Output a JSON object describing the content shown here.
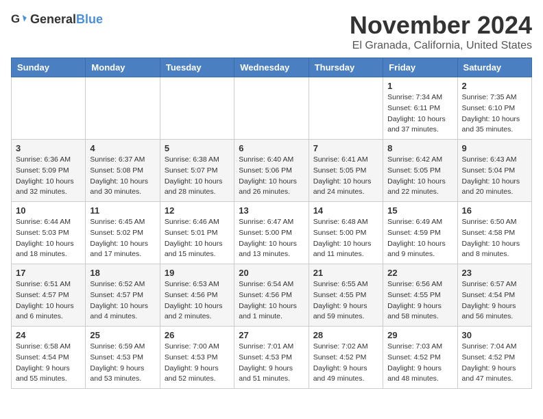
{
  "logo": {
    "general": "General",
    "blue": "Blue"
  },
  "header": {
    "month": "November 2024",
    "location": "El Granada, California, United States"
  },
  "days_of_week": [
    "Sunday",
    "Monday",
    "Tuesday",
    "Wednesday",
    "Thursday",
    "Friday",
    "Saturday"
  ],
  "weeks": [
    [
      {
        "day": "",
        "info": ""
      },
      {
        "day": "",
        "info": ""
      },
      {
        "day": "",
        "info": ""
      },
      {
        "day": "",
        "info": ""
      },
      {
        "day": "",
        "info": ""
      },
      {
        "day": "1",
        "info": "Sunrise: 7:34 AM\nSunset: 6:11 PM\nDaylight: 10 hours and 37 minutes."
      },
      {
        "day": "2",
        "info": "Sunrise: 7:35 AM\nSunset: 6:10 PM\nDaylight: 10 hours and 35 minutes."
      }
    ],
    [
      {
        "day": "3",
        "info": "Sunrise: 6:36 AM\nSunset: 5:09 PM\nDaylight: 10 hours and 32 minutes."
      },
      {
        "day": "4",
        "info": "Sunrise: 6:37 AM\nSunset: 5:08 PM\nDaylight: 10 hours and 30 minutes."
      },
      {
        "day": "5",
        "info": "Sunrise: 6:38 AM\nSunset: 5:07 PM\nDaylight: 10 hours and 28 minutes."
      },
      {
        "day": "6",
        "info": "Sunrise: 6:40 AM\nSunset: 5:06 PM\nDaylight: 10 hours and 26 minutes."
      },
      {
        "day": "7",
        "info": "Sunrise: 6:41 AM\nSunset: 5:05 PM\nDaylight: 10 hours and 24 minutes."
      },
      {
        "day": "8",
        "info": "Sunrise: 6:42 AM\nSunset: 5:05 PM\nDaylight: 10 hours and 22 minutes."
      },
      {
        "day": "9",
        "info": "Sunrise: 6:43 AM\nSunset: 5:04 PM\nDaylight: 10 hours and 20 minutes."
      }
    ],
    [
      {
        "day": "10",
        "info": "Sunrise: 6:44 AM\nSunset: 5:03 PM\nDaylight: 10 hours and 18 minutes."
      },
      {
        "day": "11",
        "info": "Sunrise: 6:45 AM\nSunset: 5:02 PM\nDaylight: 10 hours and 17 minutes."
      },
      {
        "day": "12",
        "info": "Sunrise: 6:46 AM\nSunset: 5:01 PM\nDaylight: 10 hours and 15 minutes."
      },
      {
        "day": "13",
        "info": "Sunrise: 6:47 AM\nSunset: 5:00 PM\nDaylight: 10 hours and 13 minutes."
      },
      {
        "day": "14",
        "info": "Sunrise: 6:48 AM\nSunset: 5:00 PM\nDaylight: 10 hours and 11 minutes."
      },
      {
        "day": "15",
        "info": "Sunrise: 6:49 AM\nSunset: 4:59 PM\nDaylight: 10 hours and 9 minutes."
      },
      {
        "day": "16",
        "info": "Sunrise: 6:50 AM\nSunset: 4:58 PM\nDaylight: 10 hours and 8 minutes."
      }
    ],
    [
      {
        "day": "17",
        "info": "Sunrise: 6:51 AM\nSunset: 4:57 PM\nDaylight: 10 hours and 6 minutes."
      },
      {
        "day": "18",
        "info": "Sunrise: 6:52 AM\nSunset: 4:57 PM\nDaylight: 10 hours and 4 minutes."
      },
      {
        "day": "19",
        "info": "Sunrise: 6:53 AM\nSunset: 4:56 PM\nDaylight: 10 hours and 2 minutes."
      },
      {
        "day": "20",
        "info": "Sunrise: 6:54 AM\nSunset: 4:56 PM\nDaylight: 10 hours and 1 minute."
      },
      {
        "day": "21",
        "info": "Sunrise: 6:55 AM\nSunset: 4:55 PM\nDaylight: 9 hours and 59 minutes."
      },
      {
        "day": "22",
        "info": "Sunrise: 6:56 AM\nSunset: 4:55 PM\nDaylight: 9 hours and 58 minutes."
      },
      {
        "day": "23",
        "info": "Sunrise: 6:57 AM\nSunset: 4:54 PM\nDaylight: 9 hours and 56 minutes."
      }
    ],
    [
      {
        "day": "24",
        "info": "Sunrise: 6:58 AM\nSunset: 4:54 PM\nDaylight: 9 hours and 55 minutes."
      },
      {
        "day": "25",
        "info": "Sunrise: 6:59 AM\nSunset: 4:53 PM\nDaylight: 9 hours and 53 minutes."
      },
      {
        "day": "26",
        "info": "Sunrise: 7:00 AM\nSunset: 4:53 PM\nDaylight: 9 hours and 52 minutes."
      },
      {
        "day": "27",
        "info": "Sunrise: 7:01 AM\nSunset: 4:53 PM\nDaylight: 9 hours and 51 minutes."
      },
      {
        "day": "28",
        "info": "Sunrise: 7:02 AM\nSunset: 4:52 PM\nDaylight: 9 hours and 49 minutes."
      },
      {
        "day": "29",
        "info": "Sunrise: 7:03 AM\nSunset: 4:52 PM\nDaylight: 9 hours and 48 minutes."
      },
      {
        "day": "30",
        "info": "Sunrise: 7:04 AM\nSunset: 4:52 PM\nDaylight: 9 hours and 47 minutes."
      }
    ]
  ]
}
